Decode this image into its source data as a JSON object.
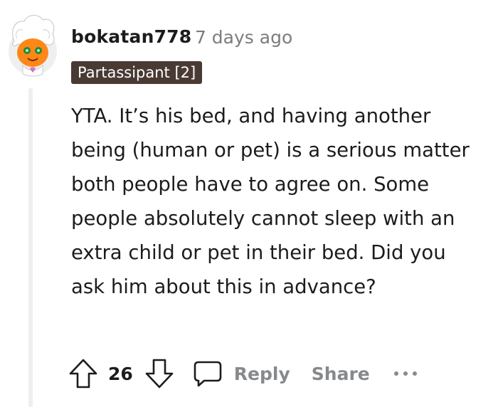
{
  "comment": {
    "username": "bokatan778",
    "separator": "·",
    "timestamp": "7 days ago",
    "flair": "Partassipant [2]",
    "body": "YTA. It’s his bed, and having another being (human or pet) is a serious matter both people have to agree on. Some people absolutely cannot sleep with an extra child or pet in their bed. Did you ask him about this in advance?"
  },
  "actions": {
    "upvote_icon": "arrow-up-outline-icon",
    "vote_count": "26",
    "downvote_icon": "arrow-down-outline-icon",
    "reply_icon": "speech-bubble-icon",
    "reply_label": "Reply",
    "share_label": "Share",
    "more_icon": "three-dots-icon"
  },
  "colors": {
    "text": "#1c1c1c",
    "muted": "#7c7c7c",
    "action": "#878a8c",
    "flair_bg": "#4a3a34",
    "thread_line": "#edeff1",
    "avatar_orange": "#ff8717"
  }
}
